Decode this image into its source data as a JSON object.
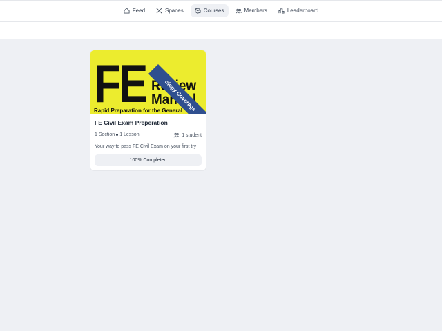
{
  "nav": {
    "items": [
      {
        "label": "Feed",
        "icon": "home-icon"
      },
      {
        "label": "Spaces",
        "icon": "tools-icon"
      },
      {
        "label": "Courses",
        "icon": "courses-icon",
        "active": true
      },
      {
        "label": "Members",
        "icon": "members-icon"
      },
      {
        "label": "Leaderboard",
        "icon": "leaderboard-icon"
      }
    ]
  },
  "course": {
    "cover": {
      "big": "FE",
      "line1": "Review",
      "line2": "Manual",
      "subtitle": "Rapid Preparation for the General",
      "ribbon": "ology Coverage"
    },
    "title": "FE Civil Exam Preperation",
    "sections": "1 Section",
    "lessons": "1 Lesson",
    "students": "1 student",
    "description": "Your way to pass FE Civil Exam on your first try",
    "progress_label": "100% Completed",
    "progress_fraction": 1.0
  },
  "colors": {
    "background": "#eef0f4",
    "cover_yellow": "#ecec2e",
    "ribbon_blue": "#2f4f8f"
  }
}
